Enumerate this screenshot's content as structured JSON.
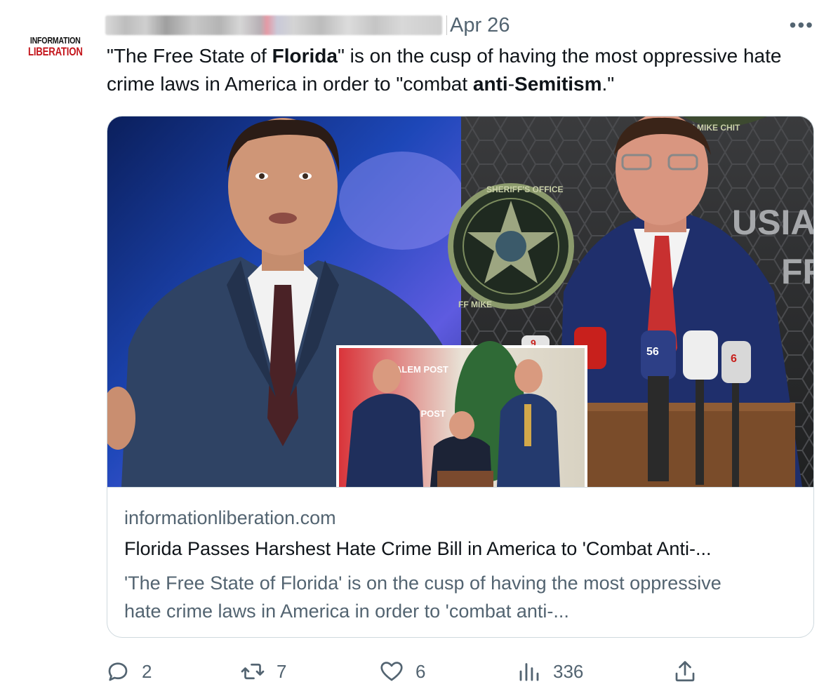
{
  "author": {
    "avatar_line1": "INFORMATION",
    "avatar_line2": "LIBERATION"
  },
  "tweet": {
    "date": "Apr 26",
    "more_label": "•••",
    "text": {
      "p1": "\"The Free State of ",
      "b1": "Florida",
      "p2": "\" is on the cusp of having the most oppressive hate crime laws in America in order to \"combat ",
      "b2": "anti",
      "p3": "-",
      "b3": "Semitism",
      "p4": ".\""
    }
  },
  "card": {
    "image_text": {
      "sheriff_ring_top": "SHERIFF'S OFFICE",
      "sheriff_ring_bottom": "FF MIKE",
      "banner_top": "FF MIKE CHIT",
      "wall_text_1": "USIA",
      "wall_text_2": "FF",
      "banner_text_1": "ALEM POST",
      "banner_text_2": "M POST",
      "mic_number_1": "9",
      "mic_number_2": "56",
      "mic_number_3": "6"
    },
    "domain": "informationliberation.com",
    "title": "Florida Passes Harshest Hate Crime Bill in America to 'Combat Anti-...",
    "description": "'The Free State of Florida' is on the cusp of having the most oppressive hate crime laws in America in order to 'combat anti-..."
  },
  "actions": {
    "reply_count": "2",
    "retweet_count": "7",
    "like_count": "6",
    "views_count": "336"
  },
  "icons": [
    "reply-icon",
    "retweet-icon",
    "like-icon",
    "views-icon",
    "share-icon",
    "more-icon"
  ],
  "colors": {
    "text": "#0f1419",
    "secondary": "#536471",
    "border": "#cfd9de",
    "logo_red": "#c4161c"
  }
}
